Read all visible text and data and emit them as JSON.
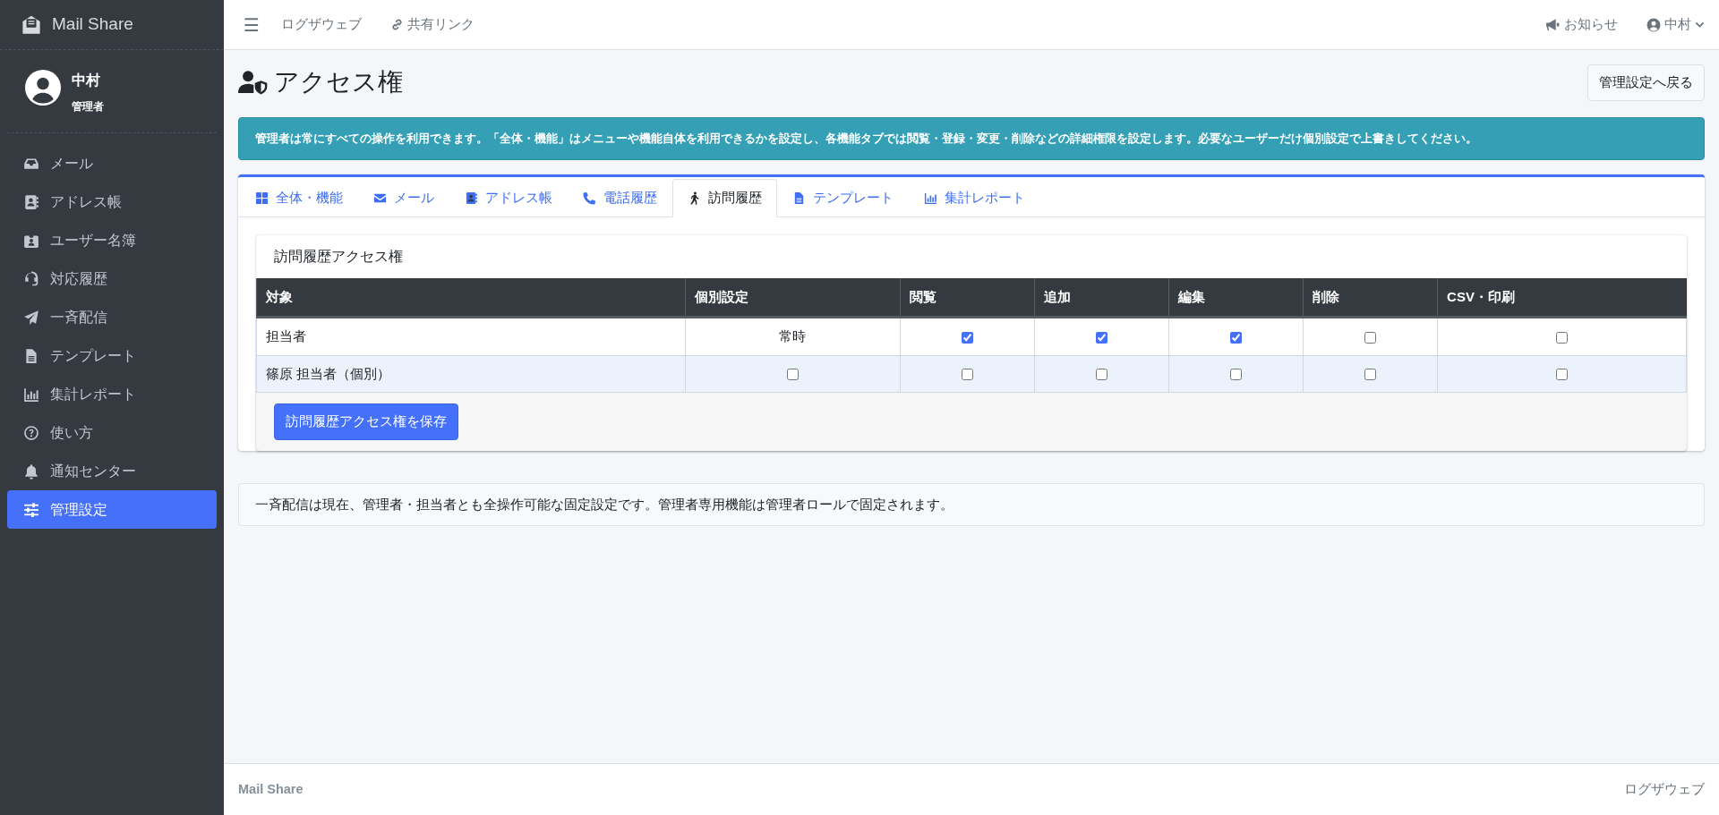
{
  "sidebar": {
    "brand": "Mail Share",
    "user": {
      "name": "中村",
      "role": "管理者"
    },
    "items": [
      {
        "label": "メール",
        "selected": false
      },
      {
        "label": "アドレス帳",
        "selected": false
      },
      {
        "label": "ユーザー名簿",
        "selected": false
      },
      {
        "label": "対応履歴",
        "selected": false
      },
      {
        "label": "一斉配信",
        "selected": false
      },
      {
        "label": "テンプレート",
        "selected": false
      },
      {
        "label": "集計レポート",
        "selected": false
      },
      {
        "label": "使い方",
        "selected": false
      },
      {
        "label": "通知センター",
        "selected": false
      },
      {
        "label": "管理設定",
        "selected": true
      }
    ]
  },
  "topbar": {
    "menu": "☰",
    "links": [
      "ログザウェブ",
      "共有リンク"
    ],
    "notice": "お知らせ",
    "user": "中村"
  },
  "page": {
    "title": "アクセス権",
    "back_button": "管理設定へ戻る",
    "alert": "管理者は常にすべての操作を利用できます。「全体・機能」はメニューや機能自体を利用できるかを設定し、各機能タブでは閲覧・登録・変更・削除などの詳細権限を設定します。必要なユーザーだけ個別設定で上書きしてください。",
    "tabs": [
      {
        "label": "全体・機能",
        "selected": false
      },
      {
        "label": "メール",
        "selected": false
      },
      {
        "label": "アドレス帳",
        "selected": false
      },
      {
        "label": "電話履歴",
        "selected": false
      },
      {
        "label": "訪問履歴",
        "selected": true
      },
      {
        "label": "テンプレート",
        "selected": false
      },
      {
        "label": "集計レポート",
        "selected": false
      }
    ],
    "panel": {
      "title": "訪問履歴アクセス権",
      "table": {
        "columns": [
          "対象",
          "個別設定",
          "閲覧",
          "追加",
          "編集",
          "削除",
          "CSV・印刷"
        ],
        "rows": [
          {
            "highlight": false,
            "cells": [
              {
                "kind": "text",
                "text": "担当者"
              },
              {
                "kind": "text",
                "text": "常時"
              },
              {
                "kind": "checkbox",
                "checked": true
              },
              {
                "kind": "checkbox",
                "checked": true
              },
              {
                "kind": "checkbox",
                "checked": true
              },
              {
                "kind": "checkbox",
                "checked": false
              },
              {
                "kind": "checkbox",
                "checked": false
              }
            ]
          },
          {
            "highlight": true,
            "cells": [
              {
                "kind": "text",
                "text": "篠原 担当者（個別）"
              },
              {
                "kind": "checkbox",
                "checked": false
              },
              {
                "kind": "checkbox",
                "checked": false
              },
              {
                "kind": "checkbox",
                "checked": false
              },
              {
                "kind": "checkbox",
                "checked": false
              },
              {
                "kind": "checkbox",
                "checked": false
              },
              {
                "kind": "checkbox",
                "checked": false
              }
            ]
          }
        ]
      },
      "save_button": "訪問履歴アクセス権を保存"
    },
    "note": "一斉配信は現在、管理者・担当者とも全操作可能な固定設定です。管理者専用機能は管理者ロールで固定されます。"
  },
  "footer": {
    "left": "Mail Share",
    "right": "ログザウェブ"
  }
}
